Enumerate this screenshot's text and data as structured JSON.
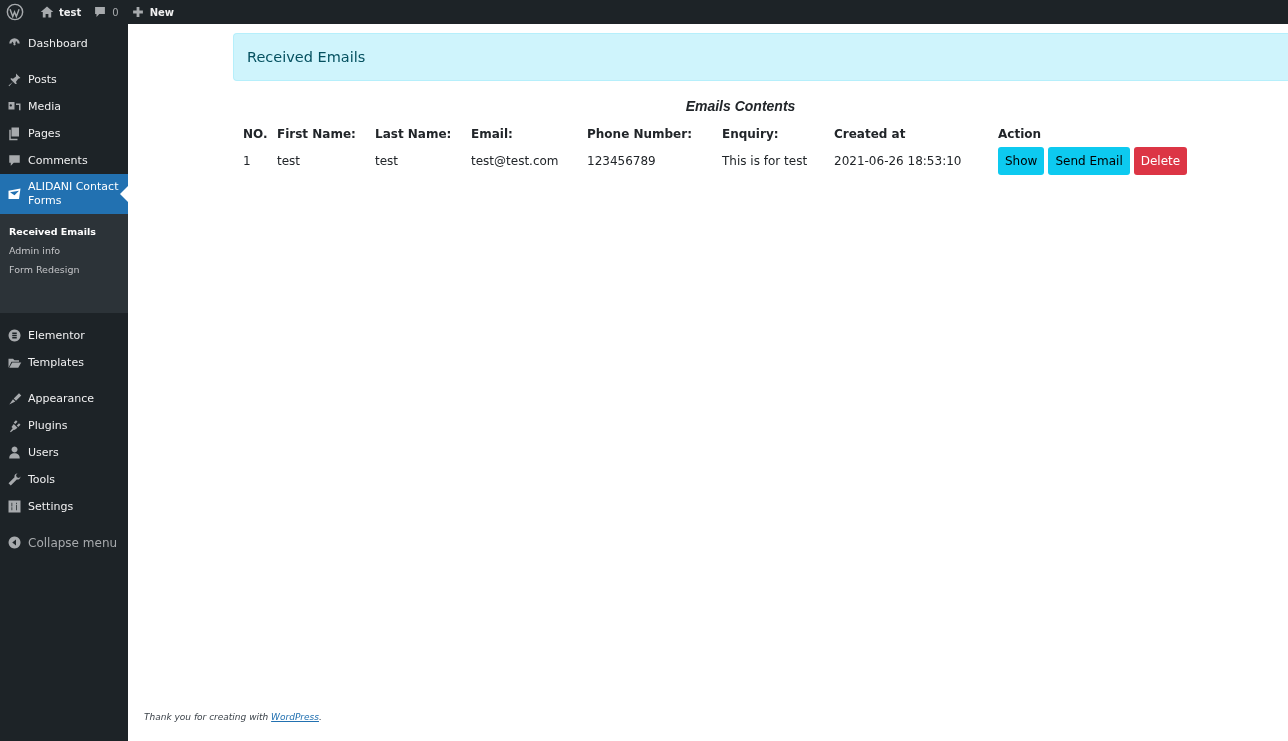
{
  "admin_bar": {
    "site_name": "test",
    "comments_count": "0",
    "new_label": "New"
  },
  "sidebar": {
    "groups": [
      {
        "items": [
          {
            "label": "Dashboard",
            "selected": false
          }
        ]
      },
      {
        "items": [
          {
            "label": "Posts",
            "selected": false
          },
          {
            "label": "Media",
            "selected": false
          },
          {
            "label": "Pages",
            "selected": false
          },
          {
            "label": "Comments",
            "selected": false
          },
          {
            "label": "ALIDANI Contact Forms",
            "selected": true,
            "children": [
              {
                "label": "Received Emails",
                "selected": true
              },
              {
                "label": "Admin info",
                "selected": false
              },
              {
                "label": "Form Redesign",
                "selected": false
              }
            ]
          }
        ]
      },
      {
        "items": [
          {
            "label": "Elementor",
            "selected": false
          },
          {
            "label": "Templates",
            "selected": false
          }
        ]
      },
      {
        "items": [
          {
            "label": "Appearance",
            "selected": false
          },
          {
            "label": "Plugins",
            "selected": false
          },
          {
            "label": "Users",
            "selected": false
          },
          {
            "label": "Tools",
            "selected": false
          },
          {
            "label": "Settings",
            "selected": false
          }
        ]
      }
    ],
    "collapse_label": "Collapse menu"
  },
  "header": {
    "title": "Received Emails"
  },
  "table": {
    "caption": "Emails Contents",
    "columns": [
      "NO.",
      "First Name:",
      "Last Name:",
      "Email:",
      "Phone Number:",
      "Enquiry:",
      "Created at",
      "Action"
    ],
    "rows": [
      {
        "cells": [
          "1",
          "test",
          "test",
          "test@test.com",
          "123456789",
          "This is for test",
          "2021-06-26 18:53:10"
        ],
        "actions": [
          {
            "label": "Show",
            "kind": "info"
          },
          {
            "label": "Send Email",
            "kind": "info"
          },
          {
            "label": "Delete",
            "kind": "danger"
          }
        ]
      }
    ]
  },
  "footer": {
    "text_before": "Thank you for creating with ",
    "link": "WordPress",
    "text_after": "."
  }
}
